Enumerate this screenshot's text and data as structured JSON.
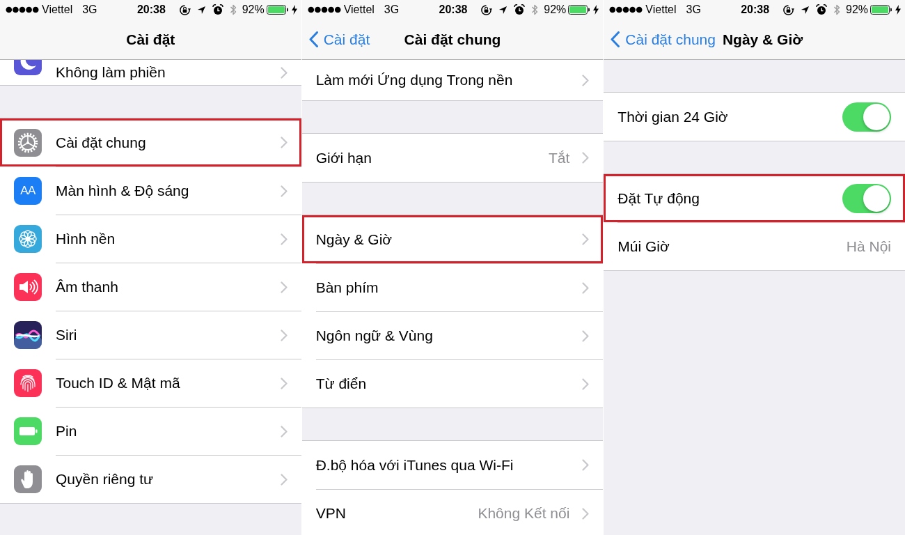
{
  "panels": [
    {
      "status_bar": {
        "carrier": "Viettel",
        "network": "3G",
        "time": "20:38",
        "battery_percent": "92%"
      },
      "nav_bar": {
        "title": "Cài đặt"
      },
      "groups": [
        {
          "clipped": true,
          "rows": [
            {
              "kind": "link",
              "label": "Không làm phiền",
              "color": "#5856d6",
              "highlighted": false
            }
          ]
        },
        {
          "clipped": false,
          "rows": [
            {
              "kind": "link",
              "label": "Cài đặt chung",
              "color": "#8e8e93",
              "highlighted": true
            },
            {
              "kind": "link",
              "label": "Màn hình & Độ sáng",
              "color": "#1b7ef5",
              "icon_text": "AA",
              "highlighted": false
            },
            {
              "kind": "link",
              "label": "Hình nền",
              "color": "#35a9dc",
              "highlighted": false
            },
            {
              "kind": "link",
              "label": "Âm thanh",
              "color": "#fc3158",
              "highlighted": false
            },
            {
              "kind": "link",
              "label": "Siri",
              "color": "#27235a",
              "highlighted": false
            },
            {
              "kind": "link",
              "label": "Touch ID & Mật mã",
              "color": "#fc3158",
              "highlighted": false
            },
            {
              "kind": "link",
              "label": "Pin",
              "color": "#4cd964",
              "highlighted": false
            },
            {
              "kind": "link",
              "label": "Quyền riêng tư",
              "color": "#8e8e93",
              "highlighted": false
            }
          ]
        }
      ]
    },
    {
      "status_bar": {
        "carrier": "Viettel",
        "network": "3G",
        "time": "20:38",
        "battery_percent": "92%"
      },
      "nav_bar": {
        "back": "Cài đặt",
        "title": "Cài đặt chung"
      },
      "groups": [
        {
          "clipped": true,
          "rows": [
            {
              "kind": "link",
              "label": "Làm mới Ứng dụng Trong nền",
              "highlighted": false
            }
          ]
        },
        {
          "clipped": false,
          "rows": [
            {
              "kind": "link",
              "label": "Giới hạn",
              "value": "Tắt",
              "highlighted": false
            }
          ]
        },
        {
          "clipped": false,
          "rows": [
            {
              "kind": "link",
              "label": "Ngày & Giờ",
              "highlighted": true
            },
            {
              "kind": "link",
              "label": "Bàn phím",
              "highlighted": false
            },
            {
              "kind": "link",
              "label": "Ngôn ngữ & Vùng",
              "highlighted": false
            },
            {
              "kind": "link",
              "label": "Từ điển",
              "highlighted": false
            }
          ]
        },
        {
          "clipped": false,
          "rows": [
            {
              "kind": "link",
              "label": "Đ.bộ hóa với iTunes qua Wi-Fi",
              "highlighted": false
            },
            {
              "kind": "link",
              "label": "VPN",
              "value": "Không Kết nối",
              "highlighted": false
            }
          ]
        }
      ]
    },
    {
      "status_bar": {
        "carrier": "Viettel",
        "network": "3G",
        "time": "20:38",
        "battery_percent": "92%"
      },
      "nav_bar": {
        "back": "Cài đặt chung",
        "title": "Ngày & Giờ"
      },
      "groups": [
        {
          "clipped": false,
          "rows": [
            {
              "kind": "toggle",
              "label": "Thời gian 24 Giờ",
              "on": true,
              "highlighted": false
            }
          ]
        },
        {
          "clipped": false,
          "rows": [
            {
              "kind": "toggle",
              "label": "Đặt Tự động",
              "on": true,
              "highlighted": true
            },
            {
              "kind": "info",
              "label": "Múi Giờ",
              "value": "Hà Nội",
              "highlighted": false
            }
          ]
        }
      ]
    }
  ]
}
